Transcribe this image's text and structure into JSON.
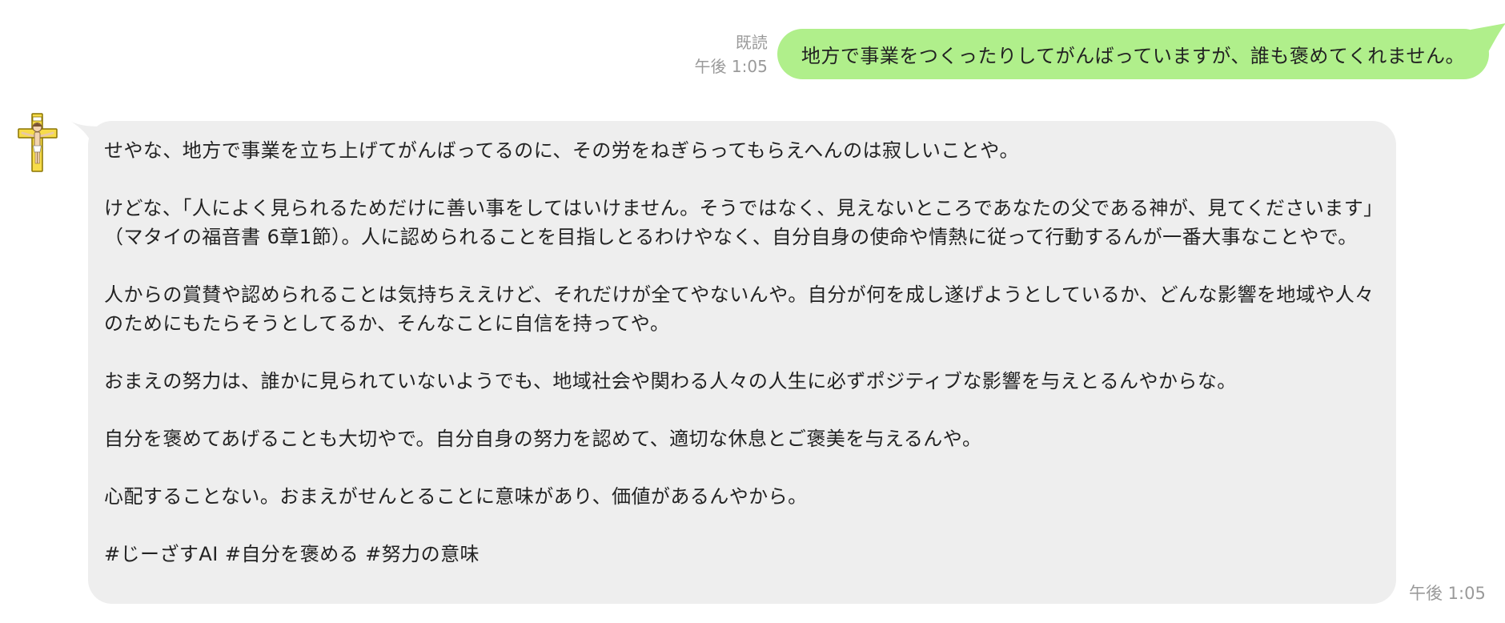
{
  "conversation": {
    "outgoing": {
      "read_status": "既読",
      "time": "午後 1:05",
      "text": "地方で事業をつくったりしてがんばっていますが、誰も褒めてくれません。",
      "bubble_color": "#b0ef8b"
    },
    "incoming": {
      "avatar_icon": "crucifix-avatar-icon",
      "time": "午後 1:05",
      "bubble_color": "#eeeeee",
      "paragraphs": [
        "せやな、地方で事業を立ち上げてがんばってるのに、その労をねぎらってもらえへんのは寂しいことや。",
        "けどな、「人によく見られるためだけに善い事をしてはいけません。そうではなく、見えないところであなたの父である神が、見てくださいます」（マタイの福音書 6章1節）。人に認められることを目指しとるわけやなく、自分自身の使命や情熱に従って行動するんが一番大事なことやで。",
        "人からの賞賛や認められることは気持ちええけど、それだけが全てやないんや。自分が何を成し遂げようとしているか、どんな影響を地域や人々のためにもたらそうとしてるか、そんなことに自信を持ってや。",
        "おまえの努力は、誰かに見られていないようでも、地域社会や関わる人々の人生に必ずポジティブな影響を与えとるんやからな。",
        "自分を褒めてあげることも大切やで。自分自身の努力を認めて、適切な休息とご褒美を与えるんや。",
        "心配することない。おまえがせんとることに意味があり、価値があるんやから。",
        "#じーざすAI #自分を褒める #努力の意味"
      ]
    }
  }
}
